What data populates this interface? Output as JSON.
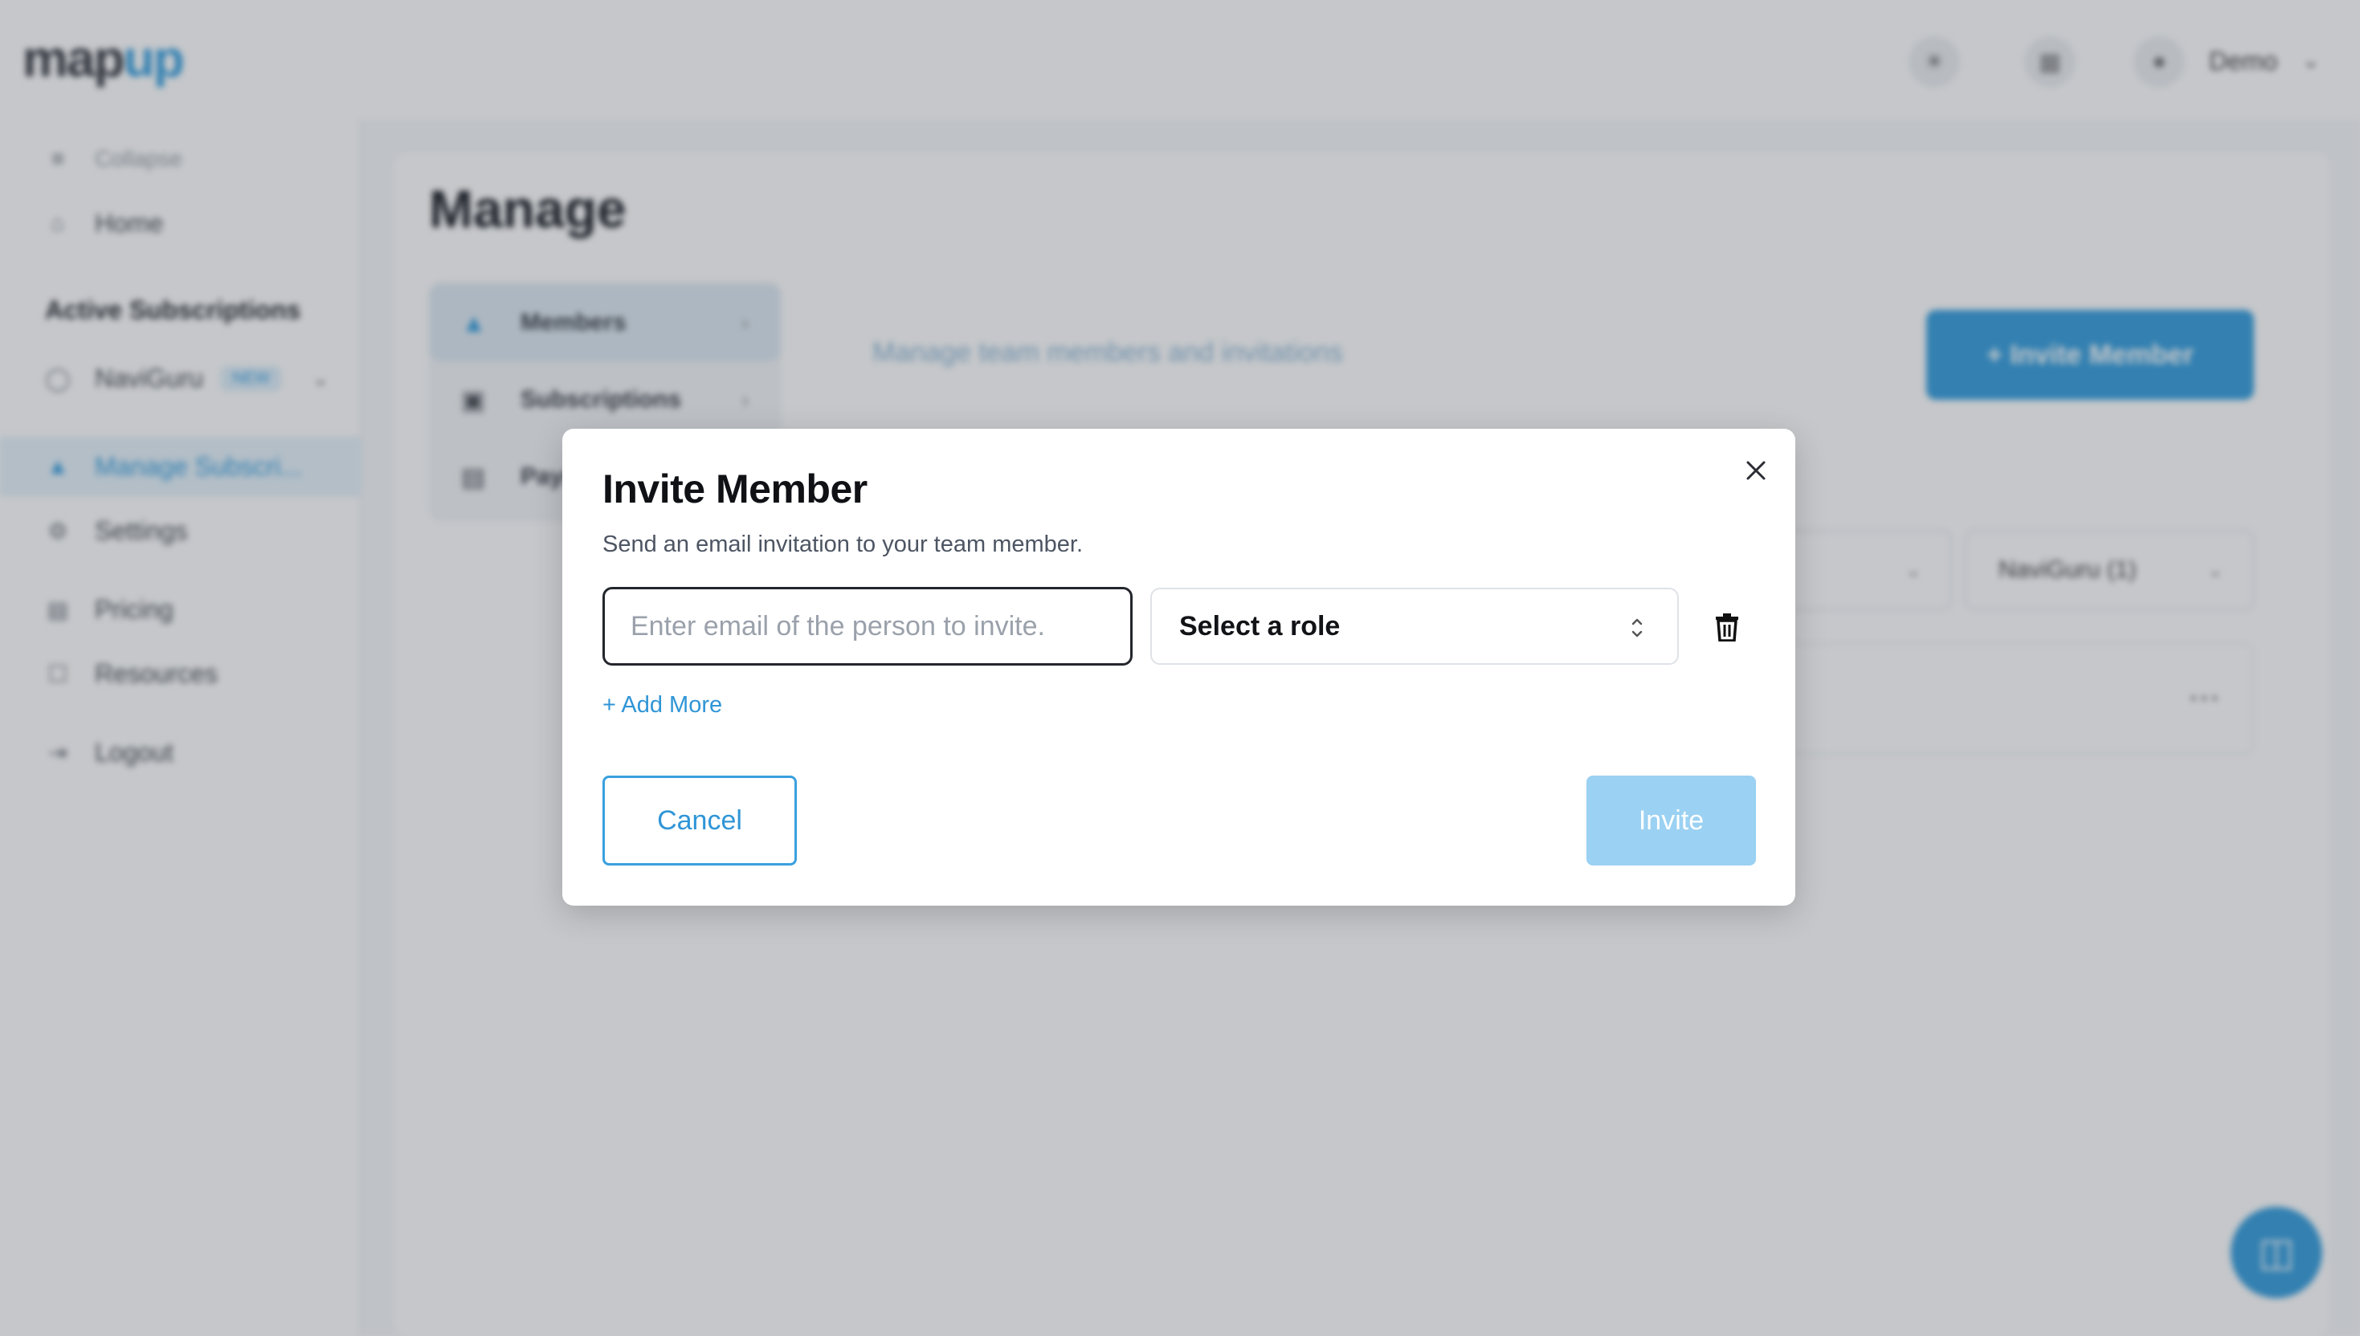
{
  "app": {
    "logo_part1": "map",
    "logo_part2": "up",
    "user_name": "Demo",
    "accent_color": "#3aa0de"
  },
  "sidebar": {
    "collapse_label": "Collapse",
    "home_label": "Home",
    "section_heading": "Active Subscriptions",
    "subscription_label": "NaviGuru",
    "subscription_badge": "NEW",
    "items": [
      {
        "label": "Manage Subscri...",
        "icon": "user-icon"
      },
      {
        "label": "Settings",
        "icon": "gear-icon"
      },
      {
        "label": "Pricing",
        "icon": "pricing-icon"
      },
      {
        "label": "Resources",
        "icon": "resources-icon"
      },
      {
        "label": "Logout",
        "icon": "logout-icon"
      }
    ]
  },
  "main": {
    "title": "Manage",
    "tabs": [
      {
        "label": "Members",
        "icon": "user-icon"
      },
      {
        "label": "Subscriptions",
        "icon": "subscriptions-icon"
      },
      {
        "label": "Payments",
        "icon": "payments-icon"
      }
    ],
    "subtitle": "Manage team members and invitations",
    "invite_button": "+ Invite Member",
    "filter_label": "NaviGuru (1)"
  },
  "modal": {
    "title": "Invite Member",
    "description": "Send an email invitation to your team member.",
    "email_placeholder": "Enter email of the person to invite.",
    "role_select_label": "Select a role",
    "add_more_label": "+ Add More",
    "cancel_label": "Cancel",
    "invite_label": "Invite",
    "invite_disabled": true
  }
}
